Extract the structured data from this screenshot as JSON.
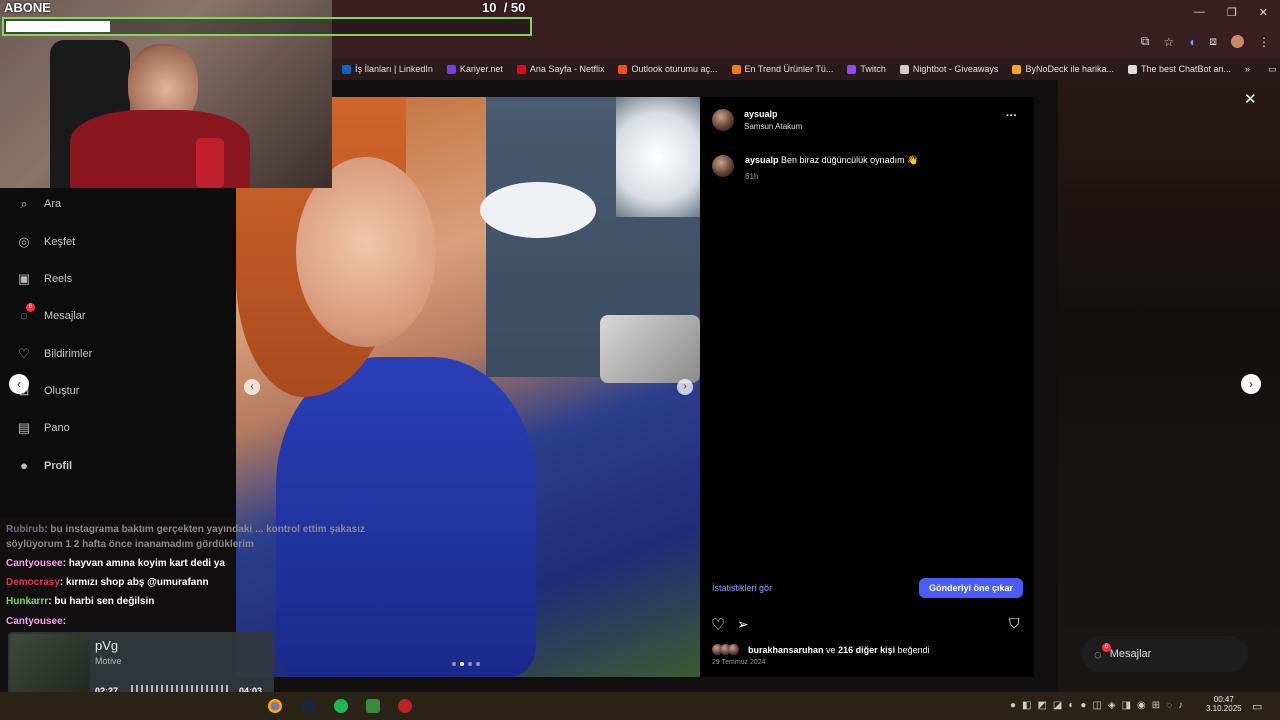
{
  "stream": {
    "goal_label": "ABONE",
    "goal_count": "10",
    "goal_total": "/ 50",
    "goal_progress": 0.2
  },
  "bookmarks": [
    {
      "label": "İş İlanları | LinkedIn",
      "color": "#0a66c2",
      "icon": "linkedin-icon"
    },
    {
      "label": "Kariyer.net",
      "color": "#7b3fe4",
      "icon": "kariyer-icon"
    },
    {
      "label": "Ana Sayfa - Netflix",
      "color": "#e50914",
      "icon": "netflix-icon"
    },
    {
      "label": "Outlook oturumu aç...",
      "color": "#f25022",
      "icon": "microsoft-icon"
    },
    {
      "label": "En Trend Ürünler Tü...",
      "color": "#f27a1a",
      "icon": "trendyol-icon"
    },
    {
      "label": "Twitch",
      "color": "#9146ff",
      "icon": "twitch-icon"
    },
    {
      "label": "Nightbot - Giveaways",
      "color": "#cccccc",
      "icon": "nightbot-icon"
    },
    {
      "label": "ByNoDeck ile harika...",
      "color": "#f5a623",
      "icon": "bynodeck-icon"
    },
    {
      "label": "The best ChatBot an...",
      "color": "#dddddd",
      "icon": "chatbot-icon"
    }
  ],
  "bookmarks_overflow": "»",
  "all_bookmarks": "Tüm Yer İşaretleri",
  "nav": {
    "items": [
      {
        "label": "Ara",
        "icon": "search-icon",
        "glyph": "⌕"
      },
      {
        "label": "Keşfet",
        "icon": "compass-icon",
        "glyph": "◎"
      },
      {
        "label": "Reels",
        "icon": "reels-icon",
        "glyph": "▣"
      },
      {
        "label": "Mesajlar",
        "icon": "messenger-icon",
        "glyph": "◌",
        "badge": "6"
      },
      {
        "label": "Bildirimler",
        "icon": "heart-icon",
        "glyph": "♡"
      },
      {
        "label": "Oluştur",
        "icon": "plus-square-icon",
        "glyph": "⊞"
      },
      {
        "label": "Pano",
        "icon": "dashboard-icon",
        "glyph": "▤"
      },
      {
        "label": "Profil",
        "icon": "profile-avatar",
        "glyph": "●"
      }
    ]
  },
  "post": {
    "username": "aysualp",
    "location": "Samsun Atakum",
    "more": "···",
    "caption_user": "aysualp",
    "caption_text": "Ben biraz düğüncülük oynadım 👋",
    "caption_time": "61h",
    "insights": "İstatistikleri gör",
    "boost": "Gönderiyi öne çıkar",
    "likes_user": "burakhansaruhan",
    "likes_conj": "ve",
    "likes_others": "216 diğer kişi",
    "likes_suffix": "beğendi",
    "date": "29 Temmuz 2024",
    "slide_count": 4,
    "active_slide": 1
  },
  "modal": {
    "close": "✕",
    "prev": "‹",
    "next": "›"
  },
  "chat": [
    {
      "user": "Rubirub",
      "text": ": bu instagrama baktım gerçekten yayındaki ... kontrol ettim şakasız",
      "color": "#7a6e8a"
    },
    {
      "user": "",
      "text": "söylüyorum 1 2 hafta önce inanamadım gördüklerim",
      "color": "#888888"
    },
    {
      "user": "Cantyousee",
      "text": ": hayvan amına koyim kart dedi ya",
      "color": "#ff9ff3"
    },
    {
      "user": "Democrasy",
      "text": ": kırmızı shop abş @umurafann",
      "color": "#e0355a"
    },
    {
      "user": "Hunkarrr",
      "text": ": bu harbi sen değilsin",
      "color": "#7ed957"
    },
    {
      "user": "Cantyousee",
      "text": ":",
      "color": "#ff9ff3"
    }
  ],
  "music": {
    "title": "pVg",
    "artist": "Motive",
    "elapsed": "02:27",
    "duration": "04:03"
  },
  "dm_pill": {
    "label": "Mesajlar",
    "badge": "6"
  },
  "clock": {
    "time": "00:47",
    "date": "3.10.2025"
  }
}
